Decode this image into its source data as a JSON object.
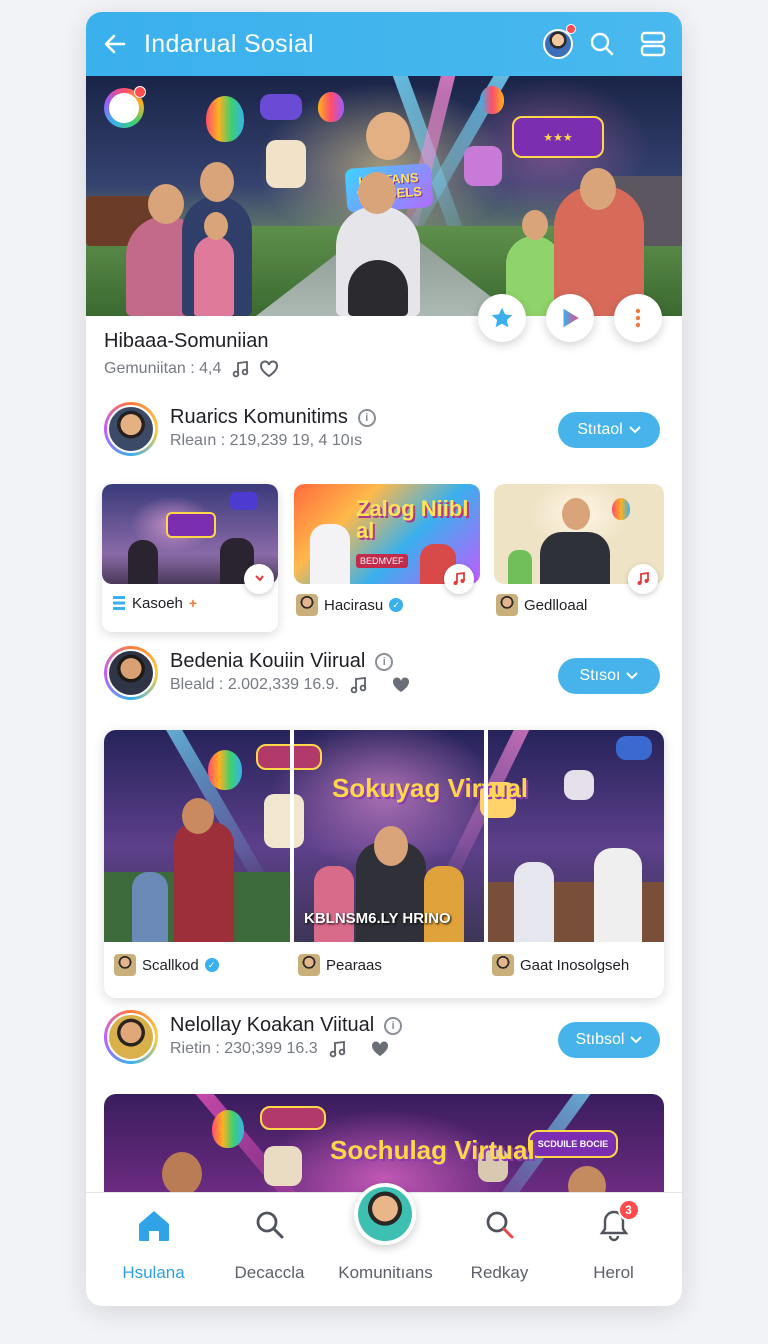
{
  "appbar": {
    "title": "Indarual Sosial",
    "icons": [
      "back-arrow-icon",
      "profile-avatar",
      "search-icon",
      "menu-icon"
    ]
  },
  "hero": {
    "sign_text": "KHI TANS VKUISELS",
    "actions": [
      "star-icon",
      "play-icon",
      "more-icon"
    ]
  },
  "feed": {
    "title": "Hibaaa-Somuniian",
    "meta_text": "Gemuniitan : 4,4"
  },
  "sections": [
    {
      "name": "Ruarics Komunitims",
      "meta": "Rleaın : 219,239 19, 4 10ıs",
      "follow_label": "Stıtaol",
      "cards": [
        {
          "user": "Kasoeh",
          "badge": "plus"
        },
        {
          "user": "Hacirasu",
          "badge": "verified",
          "thumb_text": "Zalog Niibl al",
          "thumb_sub": "BEDMVEF"
        },
        {
          "user": "Gedlloaal",
          "badge": ""
        }
      ]
    },
    {
      "name": "Bedenia Kouiin Viirual",
      "meta": "Bleald  : 2.002,339 16.9.",
      "follow_label": "Stısoı",
      "banner_title": "Sokuyag Virtual",
      "banner_caption": "KBLNSM6.LY HRINO",
      "cards": [
        {
          "user": "Scallkod",
          "badge": "verified"
        },
        {
          "user": "Pearaas",
          "badge": ""
        },
        {
          "user": "Gaat Inosolgseh",
          "badge": ""
        }
      ]
    },
    {
      "name": "Nelollay Koakan Viitual",
      "meta": "Rietin  : 230;399 16.3",
      "follow_label": "Stıbsol",
      "banner_title": "Sochulag Virtual",
      "bubble_text": "SCDUILE BOCIE"
    }
  ],
  "bottom_nav": [
    {
      "label": "Hsulana",
      "icon": "home-icon",
      "active": true
    },
    {
      "label": "Decaccla",
      "icon": "search-icon",
      "active": false
    },
    {
      "label": "Komunitıans",
      "icon": "community-avatar",
      "active": false
    },
    {
      "label": "Redkay",
      "icon": "search-icon",
      "active": false
    },
    {
      "label": "Herol",
      "icon": "bell-icon",
      "active": false,
      "badge": "3"
    }
  ],
  "colors": {
    "accent": "#3ab0ec",
    "pill": "#46b4ea",
    "badge": "#ff4b4b"
  }
}
